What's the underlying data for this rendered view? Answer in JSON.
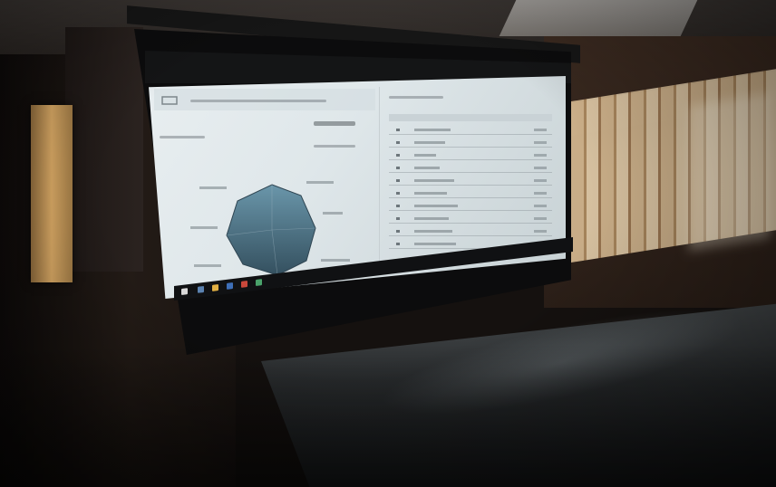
{
  "scene": {
    "description_tag": "",
    "colors": {
      "screen": "#e3eaec",
      "radar_fill": "#587f92",
      "radar_dark": "#34505f",
      "wood": "#c9995c",
      "blinds": "#e3c59a",
      "table": "#2e3133"
    }
  },
  "screen_ui": {
    "icons": [
      "window-icon",
      "radar-chart-icon",
      "table-icon",
      "taskbar-start-icon"
    ],
    "radar_axes": 8,
    "table_rows": 10
  }
}
